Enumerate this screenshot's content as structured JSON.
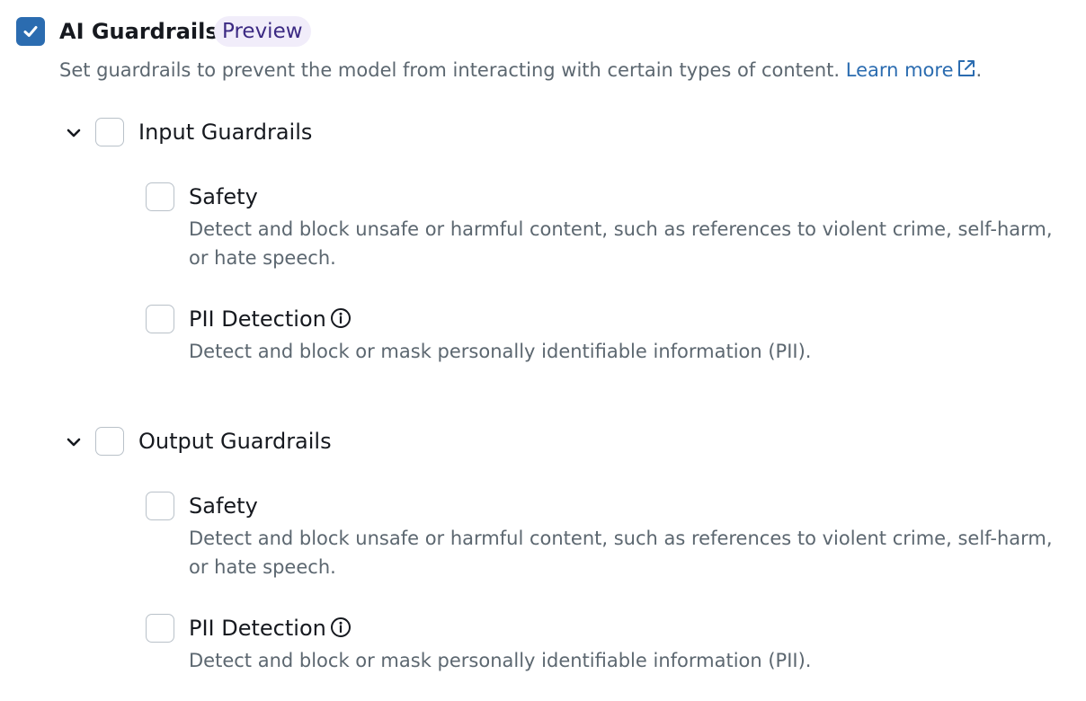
{
  "header": {
    "title": "AI Guardrails",
    "badge": "Preview",
    "description": "Set guardrails to prevent the model from interacting with certain types of content.",
    "learn_more": "Learn more",
    "trailing_period": "."
  },
  "groups": [
    {
      "label": "Input Guardrails",
      "checked": false,
      "expanded": true,
      "items": [
        {
          "label": "Safety",
          "checked": false,
          "description": "Detect and block unsafe or harmful content, such as references to violent crime, self-harm, or hate speech."
        },
        {
          "label": "PII Detection",
          "checked": false,
          "description": "Detect and block or mask personally identifiable information (PII)."
        }
      ]
    },
    {
      "label": "Output Guardrails",
      "checked": false,
      "expanded": true,
      "items": [
        {
          "label": "Safety",
          "checked": false,
          "description": "Detect and block unsafe or harmful content, such as references to violent crime, self-harm, or hate speech."
        },
        {
          "label": "PII Detection",
          "checked": false,
          "description": "Detect and block or mask personally identifiable information (PII)."
        }
      ]
    }
  ],
  "main_checked": true,
  "icons": {
    "main_checkbox": "checkmark-icon",
    "expand": "chevron-down-icon",
    "external": "external-link-icon",
    "info": "info-icon"
  },
  "colors": {
    "accent": "#2b6cb0",
    "badge_bg": "#f1edfa",
    "badge_text": "#3c2a83",
    "text": "#16191f",
    "muted": "#5c6770",
    "checkbox_border": "#b9c1c9"
  }
}
